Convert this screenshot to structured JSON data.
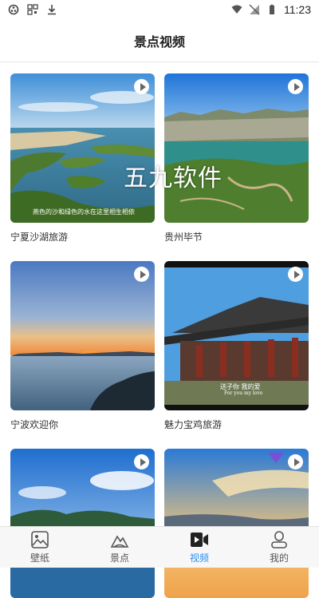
{
  "status": {
    "time": "11:23"
  },
  "header": {
    "title": "景点视频"
  },
  "videos": [
    {
      "caption": "宁夏沙湖旅游",
      "overlay": "燕色的沙和绿色的水在这里相生相依"
    },
    {
      "caption": "贵州毕节",
      "overlay": ""
    },
    {
      "caption": "宁波欢迎你",
      "overlay": ""
    },
    {
      "caption": "魅力宝鸡旅游",
      "overlay": "送子你 我的爱",
      "overlay2": "For you my love"
    },
    {
      "caption": "",
      "overlay": ""
    },
    {
      "caption": "",
      "overlay": ""
    }
  ],
  "watermark": "五九软件",
  "tabs": [
    {
      "label": "壁纸",
      "icon": "image-icon"
    },
    {
      "label": "景点",
      "icon": "mountain-icon"
    },
    {
      "label": "视频",
      "icon": "video-icon",
      "active": true
    },
    {
      "label": "我的",
      "icon": "user-icon"
    }
  ],
  "colors": {
    "accent": "#2d8cf0"
  }
}
